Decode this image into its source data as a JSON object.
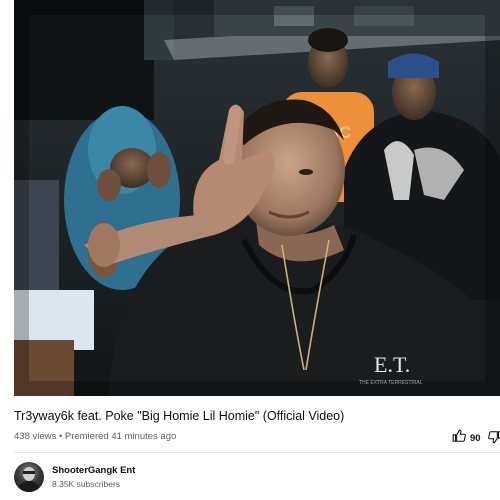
{
  "video": {
    "title": "Tr3yway6k feat. Poke \"Big Homie Lil Homie\" (Official Video)",
    "views": "438 views",
    "separator": "•",
    "premiered": "Premiered 41 minutes ago",
    "likes": "90",
    "shirt_print": "E.T.",
    "shirt_sub": "THE EXTRA TERRESTRIAL",
    "orange_shirt_text": "NESC"
  },
  "channel": {
    "name": "ShooterGangk Ent",
    "subscribers": "8.35K subscribers"
  },
  "icons": {
    "like": "thumbs-up-icon",
    "dislike": "thumbs-down-icon"
  },
  "colors": {
    "text_primary": "#0f0f0f",
    "text_secondary": "#606060",
    "divider": "#e5e5e5"
  }
}
